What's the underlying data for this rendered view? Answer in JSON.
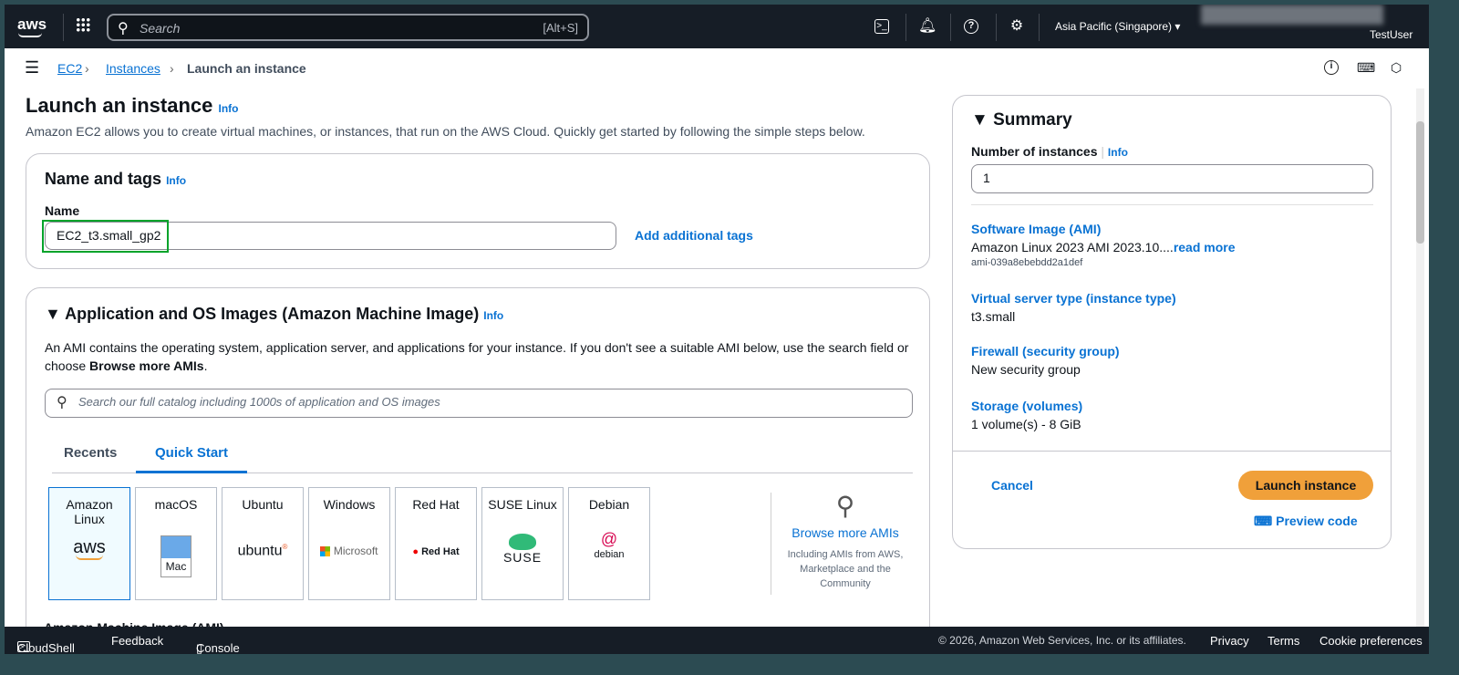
{
  "topbar": {
    "logo": "aws",
    "search_placeholder": "Search",
    "search_shortcut": "[Alt+S]",
    "region": "Asia Pacific (Singapore)",
    "user": "TestUser"
  },
  "breadcrumb": {
    "items": [
      "EC2",
      "Instances",
      "Launch an instance"
    ]
  },
  "page": {
    "title": "Launch an instance",
    "info": "Info",
    "description": "Amazon EC2 allows you to create virtual machines, or instances, that run on the AWS Cloud. Quickly get started by following the simple steps below."
  },
  "name_tags": {
    "title": "Name and tags",
    "info": "Info",
    "name_label": "Name",
    "name_value": "EC2_t3.small_gp2",
    "add_tags": "Add additional tags"
  },
  "ami": {
    "title": "Application and OS Images (Amazon Machine Image)",
    "info": "Info",
    "description": "An AMI contains the operating system, application server, and applications for your instance. If you don't see a suitable AMI below, use the search field or choose",
    "description_bold": "Browse more AMIs",
    "description_end": ".",
    "search_placeholder": "Search our full catalog including 1000s of application and OS images",
    "tabs": [
      "Recents",
      "Quick Start"
    ],
    "active_tab": "Quick Start",
    "tiles": [
      {
        "name": "Amazon Linux",
        "logo": "aws"
      },
      {
        "name": "macOS",
        "logo": "Mac"
      },
      {
        "name": "Ubuntu",
        "logo": "ubuntu"
      },
      {
        "name": "Windows",
        "logo": "Microsoft"
      },
      {
        "name": "Red Hat",
        "logo": "Red Hat"
      },
      {
        "name": "SUSE Linux",
        "logo": "SUSE"
      },
      {
        "name": "Debian",
        "logo": "debian"
      }
    ],
    "browse": "Browse more AMIs",
    "browse_sub": "Including AMIs from AWS, Marketplace and the Community",
    "ami_label": "Amazon Machine Image (AMI)"
  },
  "summary": {
    "title": "Summary",
    "count_label": "Number of instances",
    "info": "Info",
    "count": "1",
    "items": [
      {
        "label": "Software Image (AMI)",
        "value": "Amazon Linux 2023 AMI 2023.10....",
        "more": "read more",
        "sub": "ami-039a8ebebdd2a1def"
      },
      {
        "label": "Virtual server type (instance type)",
        "value": "t3.small"
      },
      {
        "label": "Firewall (security group)",
        "value": "New security group"
      },
      {
        "label": "Storage (volumes)",
        "value": "1 volume(s) - 8 GiB"
      }
    ],
    "cancel": "Cancel",
    "launch": "Launch instance",
    "preview": "Preview code"
  },
  "footer": {
    "cloudshell": "CloudShell",
    "feedback": "Feedback",
    "mobile": "Console Mobile App",
    "copyright": "© 2026, Amazon Web Services, Inc. or its affiliates.",
    "privacy": "Privacy",
    "terms": "Terms",
    "cookies": "Cookie preferences"
  },
  "colors": {
    "accent": "#0972d3",
    "launch": "#f0a03a",
    "topbar": "#161d26",
    "selected_border": "#00a32a"
  }
}
